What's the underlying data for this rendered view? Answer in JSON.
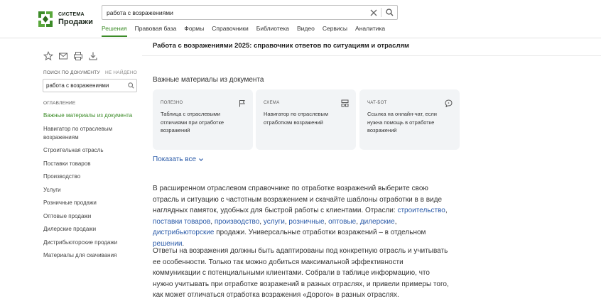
{
  "logo": {
    "top": "СИСТЕМА",
    "bottom": "Продажи"
  },
  "search": {
    "value": "работа с возражениями",
    "clear_icon": "close-icon",
    "go_icon": "search-icon"
  },
  "nav": [
    {
      "label": "Решения",
      "active": true
    },
    {
      "label": "Правовая база"
    },
    {
      "label": "Формы"
    },
    {
      "label": "Справочники"
    },
    {
      "label": "Библиотека"
    },
    {
      "label": "Видео"
    },
    {
      "label": "Сервисы"
    },
    {
      "label": "Аналитика"
    }
  ],
  "tools": [
    "star-icon",
    "mail-icon",
    "print-icon",
    "download-icon"
  ],
  "find": {
    "label": "ПОИСК ПО ДОКУМЕНТУ",
    "status": "НЕ НАЙДЕНО",
    "value": "работа с возражениями"
  },
  "toc": {
    "title": "ОГЛАВЛЕНИЕ",
    "items": [
      "Важные материалы из документа",
      "Навигатор по отраслевым возражениям",
      "Строительная отрасль",
      "Поставки товаров",
      "Производство",
      "Услуги",
      "Розничные продажи",
      "Оптовые продажи",
      "Дилерские продажи",
      "Дистрибьюторские продажи",
      "Материалы для скачивания"
    ]
  },
  "doc": {
    "title": "Работа с возражениями 2025: справочник ответов по ситуациям и отраслям"
  },
  "materials": {
    "heading": "Важные материалы из документа",
    "cards": [
      {
        "type": "ПОЛЕЗНО",
        "icon": "flag-icon",
        "text": "Таблица с отраслевыми отличиями при отработке возражений"
      },
      {
        "type": "СХЕМА",
        "icon": "scheme-icon",
        "text": "Навигатор по отраслевым отработкам возражений"
      },
      {
        "type": "ЧАТ-БОТ",
        "icon": "chat-icon",
        "text": "Ссылка на онлайн-чат, если нужна помощь в отработке возражений"
      }
    ],
    "show_all": "Показать все"
  },
  "paragraph1": {
    "t1": "В расширенном отраслевом справочнике по отработке возражений выберите свою отрасль и ситуацию с частотным возражением и скачайте шаблоны отработки в в виде наглядных памяток, удобных для быстрой работы с клиентами. Отрасли: ",
    "l1": "строительство",
    "s1": ", ",
    "l2": "поставки товаров",
    "s2": ", ",
    "l3": "производство",
    "s3": ", ",
    "l4": "услуги",
    "s4": ", ",
    "l5": "розничные",
    "s5": ", ",
    "l6": "оптовые",
    "s6": ", ",
    "l7": "дилерские",
    "s7": ", ",
    "l8": "дистрибьюторские",
    "t2": " продажи. Универсальные отработки возражений – в отдельном ",
    "l9": "решении",
    "t3": "."
  },
  "paragraph2": "Ответы на возражения должны быть адаптированы под конкретную отрасль и учитывать ее особенности. Только так можно добиться максимальной эффективности коммуникации с потенциальными клиентами. Собрали в таблице информацию, что нужно учитывать при отработке возражений в разных отраслях, и привели примеры того, как может отличаться отработка возражения «Дорого» в разных отраслях.",
  "colors": {
    "accent": "#3c8c28",
    "link": "#2a5aa8",
    "card_bg": "#f2f4f6"
  }
}
